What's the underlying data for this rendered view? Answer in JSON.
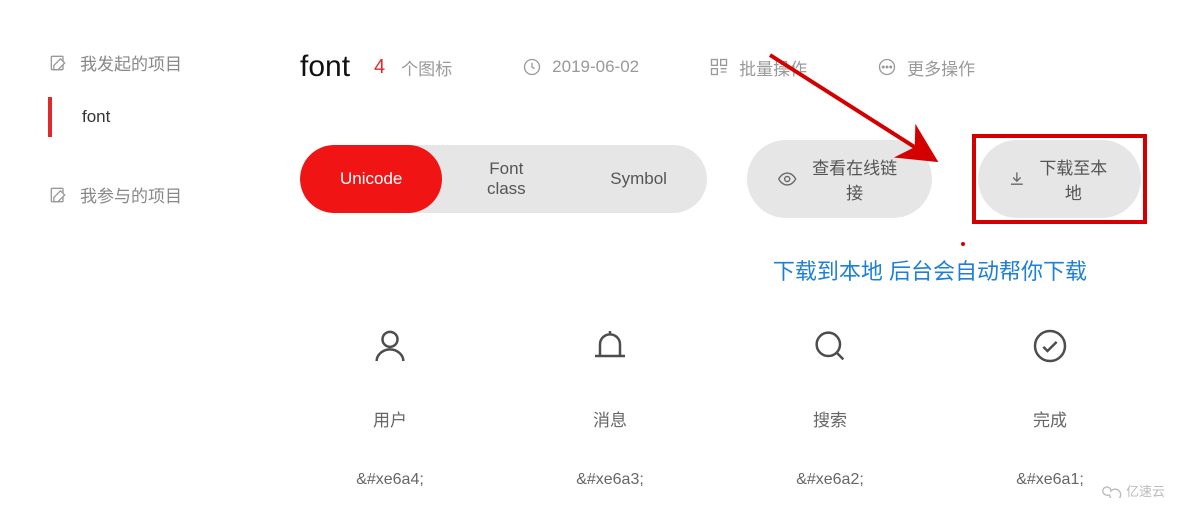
{
  "sidebar": {
    "group1_title": "我发起的项目",
    "items": [
      {
        "label": "font"
      }
    ],
    "group2_title": "我参与的项目"
  },
  "header": {
    "project_title": "font",
    "icon_count": "4",
    "icon_count_label": "个图标",
    "date": "2019-06-02",
    "batch_label": "批量操作",
    "more_label": "更多操作"
  },
  "tabs": {
    "unicode": "Unicode",
    "fontclass": "Font class",
    "symbol": "Symbol"
  },
  "actions": {
    "view_link": "查看在线链接",
    "download": "下载至本地"
  },
  "annotation": "下载到本地 后台会自动帮你下载",
  "icons": [
    {
      "name": "用户",
      "code": "&#xe6a4;"
    },
    {
      "name": "消息",
      "code": "&#xe6a3;"
    },
    {
      "name": "搜索",
      "code": "&#xe6a2;"
    },
    {
      "name": "完成",
      "code": "&#xe6a1;"
    }
  ],
  "watermark": "亿速云"
}
